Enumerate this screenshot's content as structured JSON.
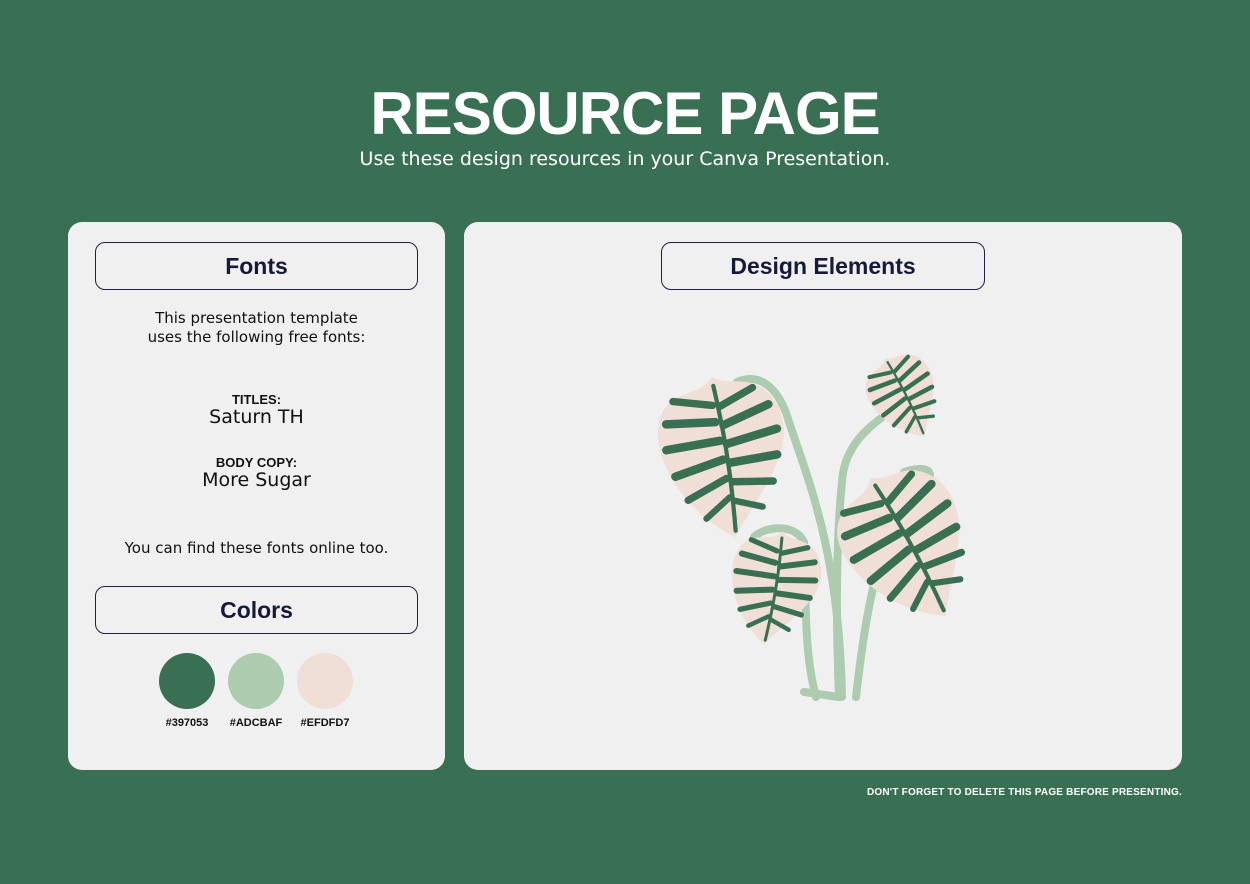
{
  "header": {
    "title": "RESOURCE PAGE",
    "subtitle": "Use these design resources in your Canva Presentation."
  },
  "fonts": {
    "heading": "Fonts",
    "intro_line1": "This presentation template",
    "intro_line2": "uses the following free fonts:",
    "titles_label": "TITLES:",
    "titles_font": "Saturn TH",
    "body_label": "BODY COPY:",
    "body_font": "More Sugar",
    "note": "You can find these fonts online too."
  },
  "colors": {
    "heading": "Colors",
    "swatches": [
      {
        "hex": "#397053",
        "label": "#397053"
      },
      {
        "hex": "#ADCBAF",
        "label": "#ADCBAF"
      },
      {
        "hex": "#EFDFD7",
        "label": "#EFDFD7"
      }
    ]
  },
  "design": {
    "heading": "Design Elements",
    "illustration": "leaf-plant-illustration"
  },
  "footer": {
    "note": "DON'T FORGET TO DELETE THIS PAGE BEFORE PRESENTING."
  }
}
